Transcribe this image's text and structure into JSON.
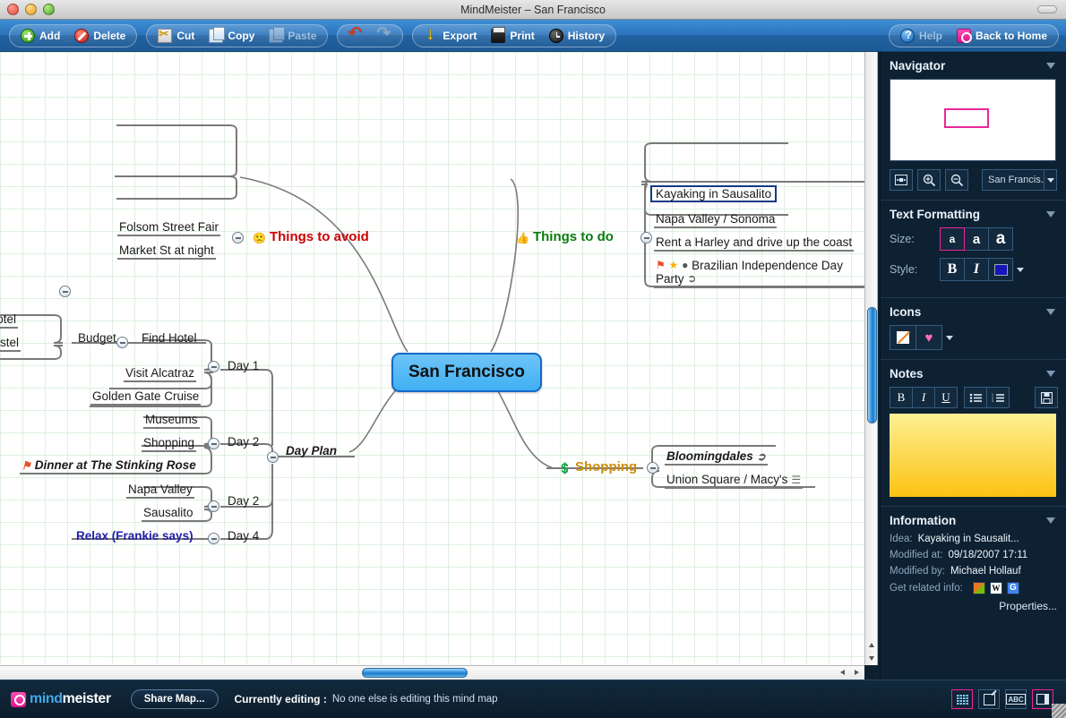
{
  "window": {
    "title": "MindMeister – San Francisco"
  },
  "toolbar": {
    "add": "Add",
    "delete": "Delete",
    "cut": "Cut",
    "copy": "Copy",
    "paste": "Paste",
    "export": "Export",
    "print": "Print",
    "history": "History",
    "help": "Help",
    "back_to_home": "Back to Home"
  },
  "map": {
    "root": "San Francisco",
    "nodes": [
      {
        "text": "Folsom Street Fair"
      },
      {
        "text": "Market St at night"
      },
      {
        "text": "Things to avoid",
        "icon": "sad-face-icon"
      },
      {
        "text": "Things to do",
        "icon": "thumbs-up-icon"
      },
      {
        "text": "Kayaking in Sausalito",
        "selected": true
      },
      {
        "text": "Napa Valley / Sonoma"
      },
      {
        "text": "Rent a Harley and drive up the coast"
      },
      {
        "text": "Brazilian Independence Day Party",
        "icons": "flag-icon star-icon ball-icon link-icon"
      },
      {
        "text": "ght Hotel",
        "clipped": true
      },
      {
        "text": "ap Hostel",
        "clipped": true
      },
      {
        "text": "Budget"
      },
      {
        "text": "Find Hotel"
      },
      {
        "text": "Visit Alcatraz"
      },
      {
        "text": "Golden Gate Cruise"
      },
      {
        "text": "Day 1"
      },
      {
        "text": "Museums"
      },
      {
        "text": "Shopping"
      },
      {
        "text": "Dinner at The Stinking Rose",
        "icon": "flag-icon"
      },
      {
        "text": "Day 2"
      },
      {
        "text": "Day Plan"
      },
      {
        "text": "Napa Valley"
      },
      {
        "text": "Sausalito"
      },
      {
        "text": "Day 2"
      },
      {
        "text": "Relax (Frankie says)"
      },
      {
        "text": "Day 4"
      },
      {
        "text": "Shopping",
        "icon": "money-icon"
      },
      {
        "text": "Bloomingdales",
        "icon": "link-icon"
      },
      {
        "text": "Union Square / Macy's",
        "icon": "note-icon"
      }
    ]
  },
  "sidebar": {
    "navigator": {
      "title": "Navigator",
      "zoom_value": "San Francis..."
    },
    "text_formatting": {
      "title": "Text Formatting",
      "size_label": "Size:",
      "style_label": "Style:",
      "size_small": "a",
      "size_medium": "a",
      "size_large": "a",
      "bold": "B",
      "italic": "I",
      "color": "#1515b8"
    },
    "icons": {
      "title": "Icons",
      "heart": "♥"
    },
    "notes": {
      "title": "Notes",
      "bold": "B",
      "italic": "I",
      "underline": "U",
      "value": ""
    },
    "information": {
      "title": "Information",
      "idea_label": "Idea:",
      "idea_value": "Kayaking in Sausalit...",
      "modified_at_label": "Modified at:",
      "modified_at_value": "09/18/2007 17:11",
      "modified_by_label": "Modified by:",
      "modified_by_value": "Michael Hollauf",
      "related_label": "Get related info:",
      "properties": "Properties..."
    }
  },
  "statusbar": {
    "logo_a": "mind",
    "logo_b": "meister",
    "share_map": "Share Map...",
    "editing_label": "Currently editing :",
    "editing_value": "No one else is editing this mind map"
  }
}
